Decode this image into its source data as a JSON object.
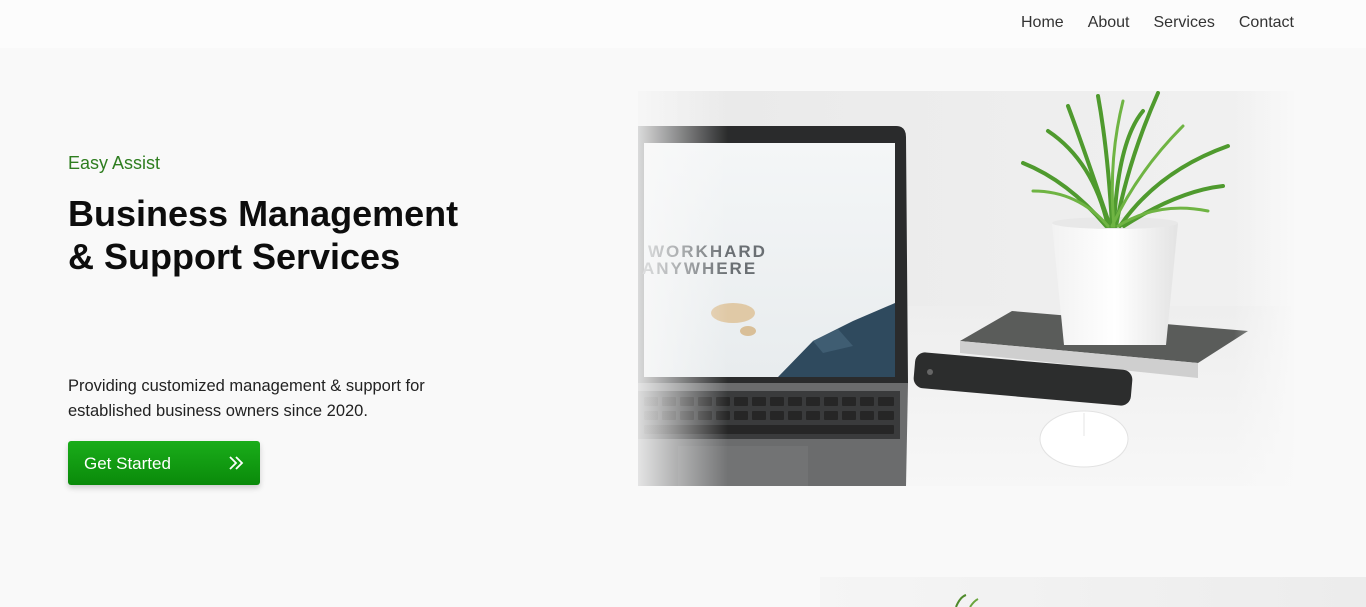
{
  "nav": {
    "items": [
      {
        "label": "Home"
      },
      {
        "label": "About"
      },
      {
        "label": "Services"
      },
      {
        "label": "Contact"
      }
    ]
  },
  "hero": {
    "eyebrow": "Easy Assist",
    "title_line1": "Business Management",
    "title_line2": "& Support Services",
    "desc_line1": "Providing customized management & support for",
    "desc_line2": "established business owners since 2020.",
    "cta_label": "Get Started",
    "cta_icon": "double-chevron-right-icon",
    "image_screen_text_line1": "WORKHARD",
    "image_screen_text_line2": "ANYWHERE"
  },
  "colors": {
    "accent_green": "#11a011",
    "eyebrow_green": "#2e7d1f",
    "page_background": "#f9f9f9"
  }
}
